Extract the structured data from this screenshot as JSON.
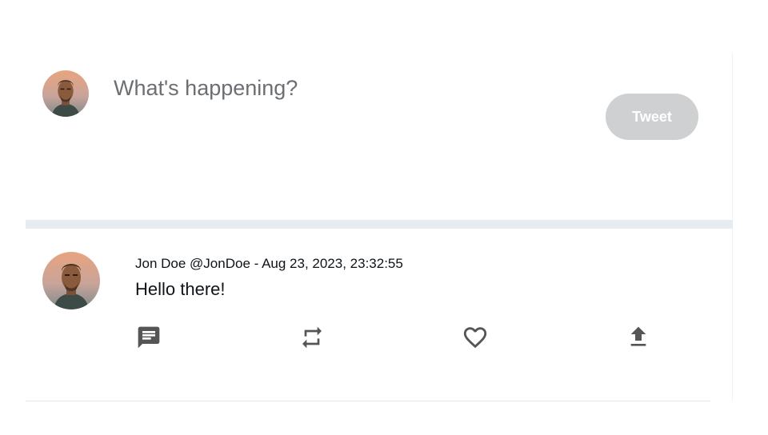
{
  "composer": {
    "placeholder": "What's happening?",
    "value": "",
    "tweet_button_label": "Tweet"
  },
  "tweet": {
    "meta": "Jon Doe @JonDoe - Aug 23, 2023, 23:32:55",
    "text": "Hello there!"
  },
  "actions": [
    {
      "icon": "reply-icon"
    },
    {
      "icon": "retweet-icon"
    },
    {
      "icon": "like-icon"
    },
    {
      "icon": "share-icon"
    }
  ],
  "colors": {
    "icon": "#555555",
    "tweet_button_bg": "#cfd0d1",
    "separator": "#e6ecf0",
    "placeholder": "#6b6f73"
  }
}
